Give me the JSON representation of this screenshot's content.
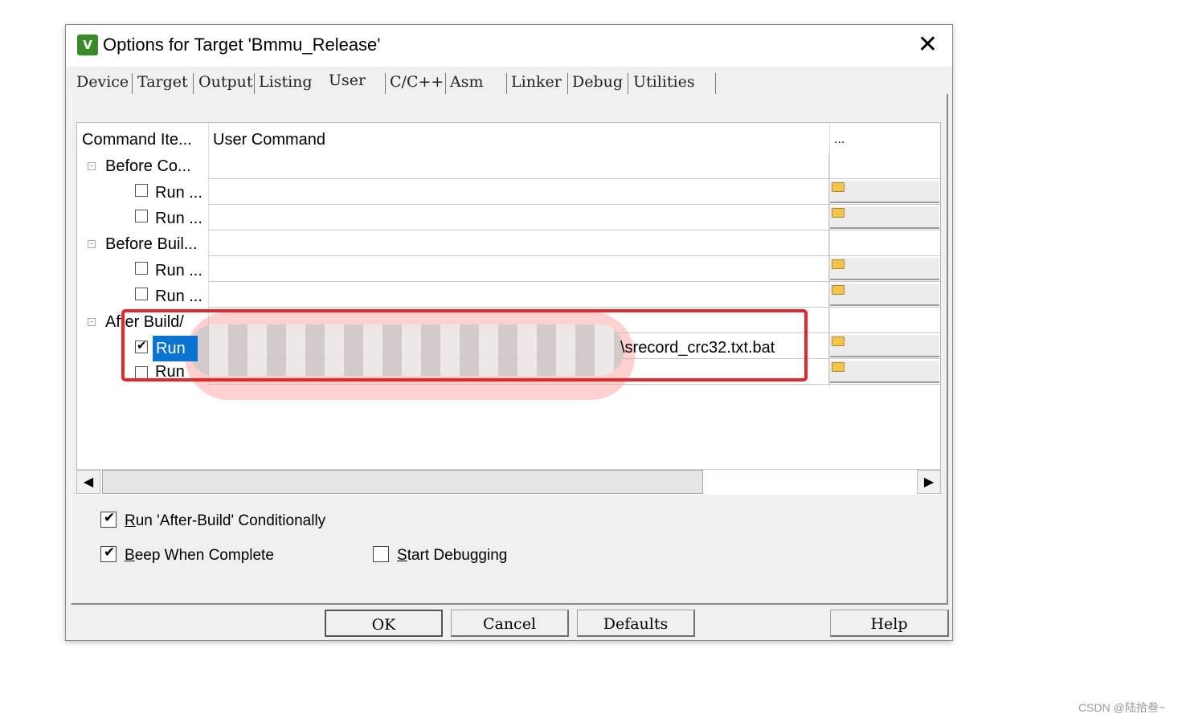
{
  "window": {
    "title": "Options for Target 'Bmmu_Release'",
    "icon_glyph": "V",
    "close_glyph": "✕"
  },
  "tabs": [
    {
      "label": "Device"
    },
    {
      "label": "Target"
    },
    {
      "label": "Output"
    },
    {
      "label": "Listing"
    },
    {
      "label": "User",
      "active": true
    },
    {
      "label": "C/C++"
    },
    {
      "label": "Asm"
    },
    {
      "label": "Linker"
    },
    {
      "label": "Debug"
    },
    {
      "label": "Utilities"
    }
  ],
  "grid": {
    "col_command_item": "Command Ite...",
    "col_user_command": "User Command",
    "col_browse": "...",
    "groups": [
      {
        "label": "Before Co...",
        "items": [
          {
            "label": "Run ...",
            "checked": false
          },
          {
            "label": "Run ...",
            "checked": false
          }
        ]
      },
      {
        "label": "Before Buil...",
        "items": [
          {
            "label": "Run ...",
            "checked": false
          },
          {
            "label": "Run ...",
            "checked": false
          }
        ]
      },
      {
        "label": "After Build/",
        "items": [
          {
            "label": "Run",
            "checked": true,
            "command": "\\srecord_crc32.txt.bat"
          },
          {
            "label": "Run",
            "checked": false
          }
        ]
      }
    ]
  },
  "scroll": {
    "left_glyph": "◀",
    "right_glyph": "▶"
  },
  "options": {
    "run_after_build": {
      "label_u": "R",
      "label_rest": "un 'After-Build' Conditionally",
      "checked": true
    },
    "beep_when_complete": {
      "label_u": "B",
      "label_rest": "eep When Complete",
      "checked": true
    },
    "start_debugging": {
      "label_u": "S",
      "label_rest": "tart Debugging",
      "checked": false
    }
  },
  "buttons": {
    "ok": "OK",
    "cancel": "Cancel",
    "defaults": "Defaults",
    "help": "Help"
  },
  "colors": {
    "selection": "#0a74d0",
    "highlight_box": "#e8262a",
    "app_icon": "#3a8a2c"
  },
  "watermark": "CSDN @陆拾叁~"
}
